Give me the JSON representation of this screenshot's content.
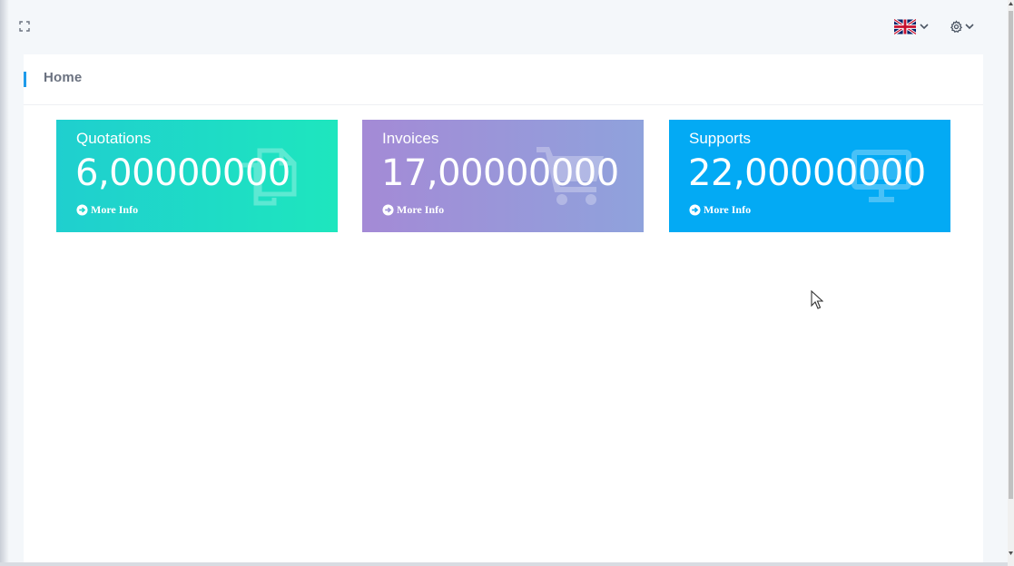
{
  "page": {
    "title": "Home"
  },
  "toolbar": {
    "fullscreen_icon": "fullscreen-icon",
    "language_icon": "uk-flag-icon",
    "settings_icon": "gear-icon"
  },
  "stats": [
    {
      "label": "Quotations",
      "value": "6,00000000",
      "link": "More Info",
      "icon": "copy-icon",
      "color_start": "#1fcfcf",
      "color_end": "#1ee6be"
    },
    {
      "label": "Invoices",
      "value": "17,00000000",
      "link": "More Info",
      "icon": "cart-icon",
      "color_start": "#a48ad6",
      "color_end": "#8fa2dc"
    },
    {
      "label": "Supports",
      "value": "22,00000000",
      "link": "More Info",
      "icon": "monitor-icon",
      "color_start": "#03aaf4",
      "color_end": "#03aaf4"
    }
  ],
  "colors": {
    "accent": "#1e9bea",
    "background": "#f4f7fa"
  }
}
